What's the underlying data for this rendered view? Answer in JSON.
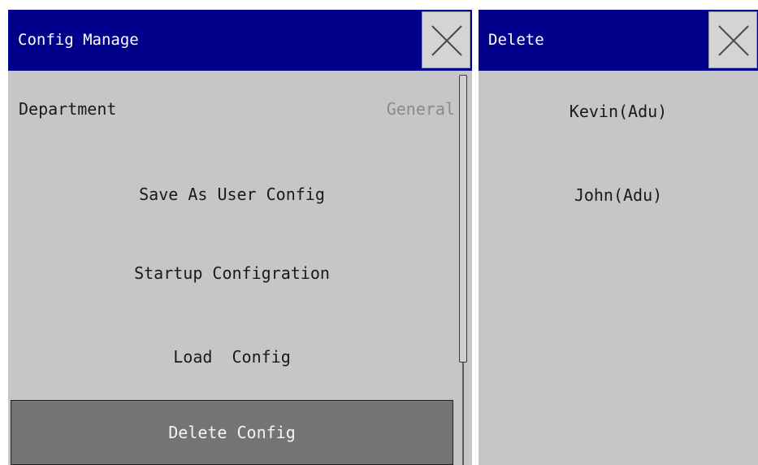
{
  "config_dialog": {
    "title": "Config Manage",
    "department_label": "Department",
    "department_value": "General",
    "save_as_user_config": "Save As User Config",
    "startup_configuration": "Startup Configration",
    "load_config": "Load  Config",
    "delete_config": "Delete Config"
  },
  "delete_dialog": {
    "title": "Delete",
    "items": [
      "Kevin(Adu)",
      "John(Adu)"
    ]
  },
  "colors": {
    "titlebar": "#00008b",
    "panel": "#c6c6c6",
    "selected": "#747474"
  },
  "icons": {
    "close": "close-icon"
  }
}
